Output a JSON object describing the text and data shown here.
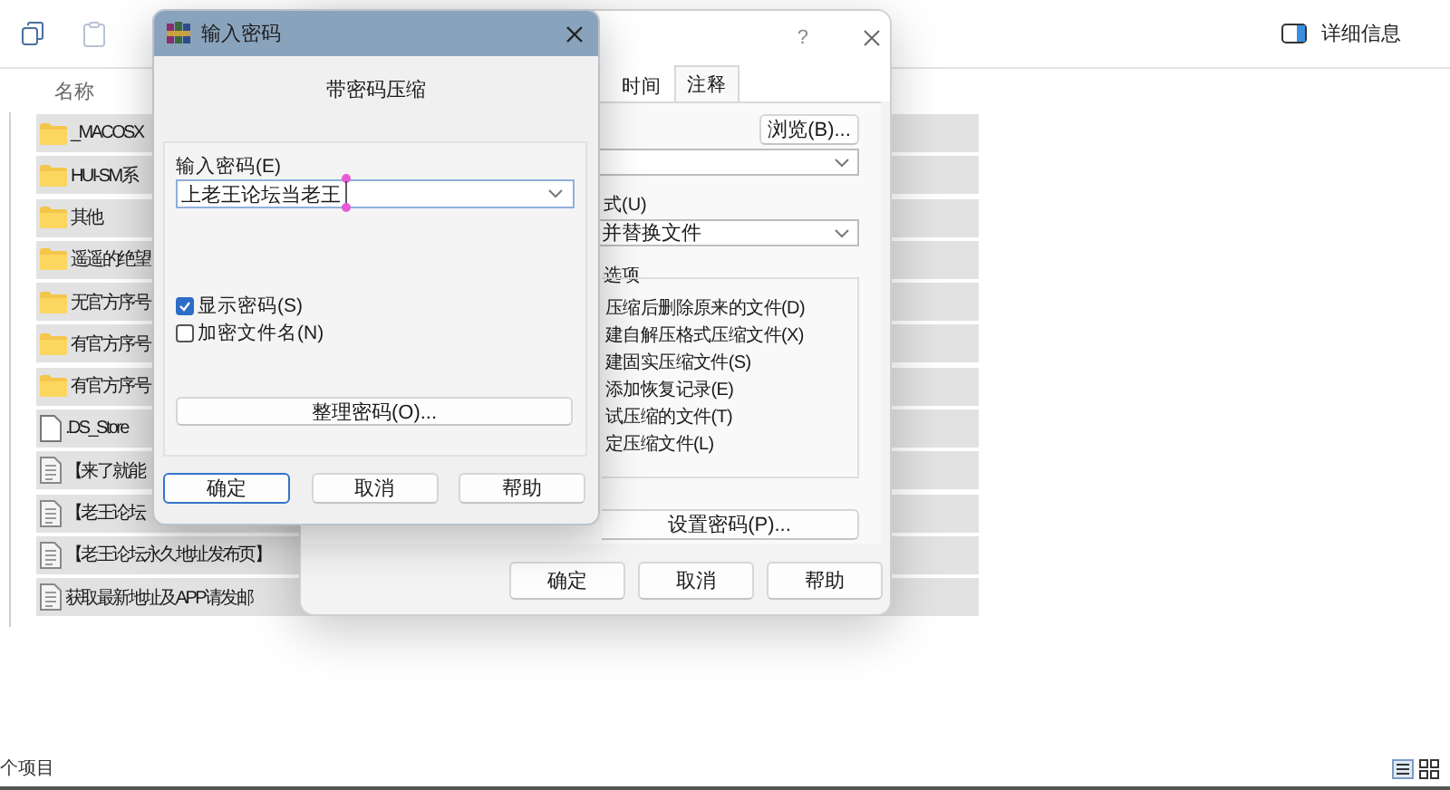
{
  "explorer": {
    "details_button": "详细信息",
    "column_header": "名称",
    "files": [
      {
        "name": "_MACOSX",
        "kind": "folder"
      },
      {
        "name": "HUI-SM系",
        "kind": "folder"
      },
      {
        "name": "其他",
        "kind": "folder"
      },
      {
        "name": "遥遥的绝望",
        "kind": "folder"
      },
      {
        "name": "无官方序号",
        "kind": "folder"
      },
      {
        "name": "有官方序号",
        "kind": "folder"
      },
      {
        "name": "有官方序号",
        "kind": "folder"
      },
      {
        "name": ".DS_Store",
        "kind": "file"
      },
      {
        "name": "【来了就能",
        "kind": "text"
      },
      {
        "name": "【老王论坛",
        "kind": "text"
      },
      {
        "name": "【老王论坛永久地址发布页】",
        "kind": "text"
      },
      {
        "name": "获取最新地址及APP请发邮",
        "kind": "text"
      }
    ],
    "status": "个项目"
  },
  "archive_dialog": {
    "help_symbol": "?",
    "tabs": [
      {
        "label": "时间",
        "selected": false
      },
      {
        "label": "注释",
        "selected": true
      }
    ],
    "browse_button": "浏览(B)...",
    "mode_label": "式(U)",
    "mode_value": "并替换文件",
    "options_group": "选项",
    "options": [
      "压缩后删除原来的文件(D)",
      "建自解压格式压缩文件(X)",
      "建固实压缩文件(S)",
      "添加恢复记录(E)",
      "试压缩的文件(T)",
      "定压缩文件(L)"
    ],
    "set_password_button": "设置密码(P)...",
    "buttons": [
      "确定",
      "取消",
      "帮助"
    ]
  },
  "password_dialog": {
    "title": "输入密码",
    "heading": "带密码压缩",
    "password_label": "输入密码(E)",
    "password_value": "上老王论坛当老王",
    "checkboxes": [
      {
        "label": "显示密码(S)",
        "checked": true
      },
      {
        "label": "加密文件名(N)",
        "checked": false
      }
    ],
    "organize_button": "整理密码(O)...",
    "buttons": [
      {
        "label": "确定",
        "focused": true
      },
      {
        "label": "取消",
        "focused": false
      },
      {
        "label": "帮助",
        "focused": false
      }
    ]
  }
}
